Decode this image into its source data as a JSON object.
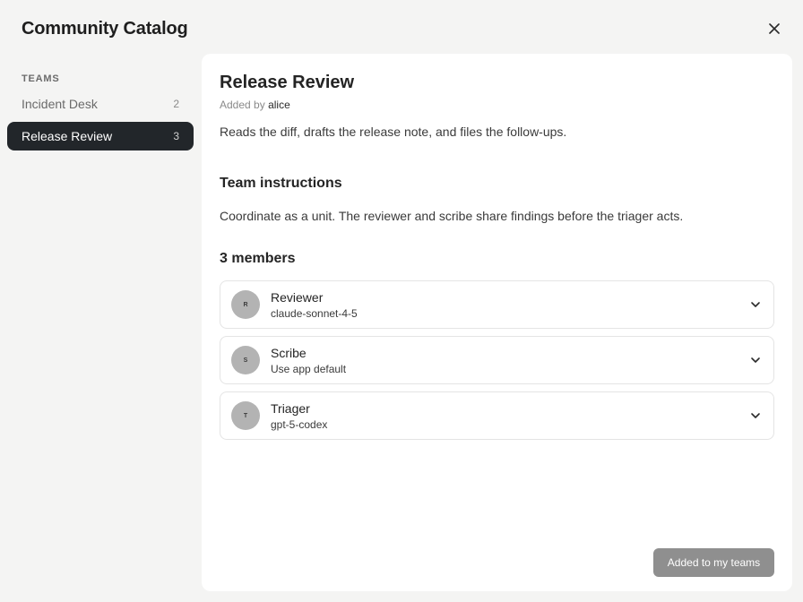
{
  "header": {
    "title": "Community Catalog",
    "close_icon": "close-icon"
  },
  "sidebar": {
    "heading": "TEAMS",
    "items": [
      {
        "label": "Incident Desk",
        "count": "2",
        "active": false
      },
      {
        "label": "Release Review",
        "count": "3",
        "active": true
      }
    ]
  },
  "detail": {
    "title": "Release Review",
    "added_by_prefix": "Added by",
    "added_by_author": "alice",
    "description": "Reads the diff, drafts the release note, and files the follow-ups.",
    "instructions_heading": "Team instructions",
    "instructions": "Coordinate as a unit. The reviewer and scribe share findings before the triager acts.",
    "members_heading": "3 members",
    "members": [
      {
        "initial": "R",
        "name": "Reviewer",
        "model": "claude-sonnet-4-5"
      },
      {
        "initial": "S",
        "name": "Scribe",
        "model": "Use app default"
      },
      {
        "initial": "T",
        "name": "Triager",
        "model": "gpt-5-codex"
      }
    ],
    "action_label": "Added to my teams"
  },
  "colors": {
    "background": "#f4f4f3",
    "active_item": "#22262a",
    "avatar": "#b3b3b3",
    "action_button": "#8f8f8f"
  }
}
